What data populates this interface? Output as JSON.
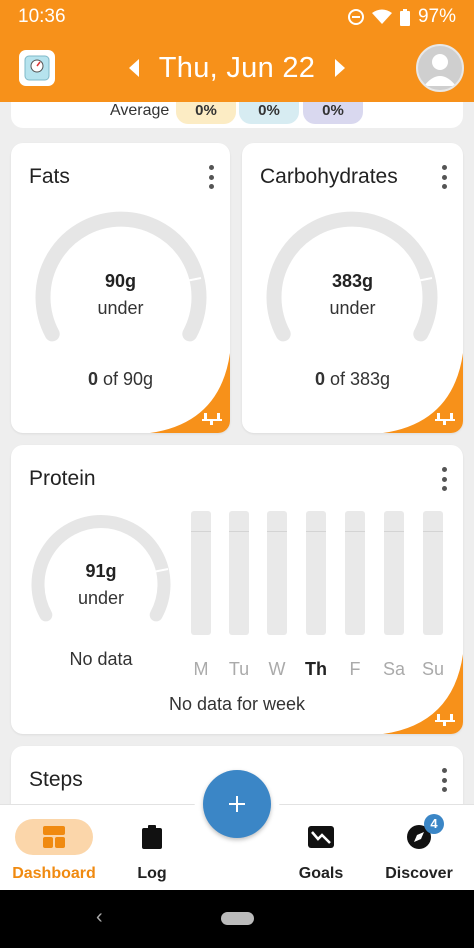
{
  "status_bar": {
    "time": "10:36",
    "battery": "97%",
    "icons": [
      "do-not-disturb-icon",
      "wifi-icon",
      "battery-icon"
    ]
  },
  "header": {
    "date": "Thu, Jun 22",
    "prev_icon": "chevron-left-icon",
    "next_icon": "chevron-right-icon",
    "scale_icon": "scale-icon",
    "avatar_icon": "user-avatar-icon"
  },
  "average": {
    "label": "Average",
    "values": [
      "0%",
      "0%",
      "0%"
    ],
    "colors": [
      "#fcecc4",
      "#d7ecf2",
      "#d9d8ef"
    ]
  },
  "fats": {
    "title": "Fats",
    "amount": "90g",
    "status": "under",
    "consumed": "0",
    "of_text": "of 90g",
    "progress": 0
  },
  "carbs": {
    "title": "Carbohydrates",
    "amount": "383g",
    "status": "under",
    "consumed": "0",
    "of_text": "of 383g",
    "progress": 0
  },
  "protein": {
    "title": "Protein",
    "amount": "91g",
    "status": "under",
    "no_data": "No data",
    "days": [
      "M",
      "Tu",
      "W",
      "Th",
      "F",
      "Sa",
      "Su"
    ],
    "today_index": 3,
    "week_message": "No data for week",
    "progress": 0
  },
  "steps": {
    "title": "Steps"
  },
  "bottom_nav": {
    "dashboard": "Dashboard",
    "log": "Log",
    "goals": "Goals",
    "discover": "Discover",
    "discover_badge": "4",
    "fab_label": "+"
  },
  "colors": {
    "accent": "#f7911a",
    "fab": "#3b86c6",
    "gauge_track": "#e6e6e6"
  }
}
